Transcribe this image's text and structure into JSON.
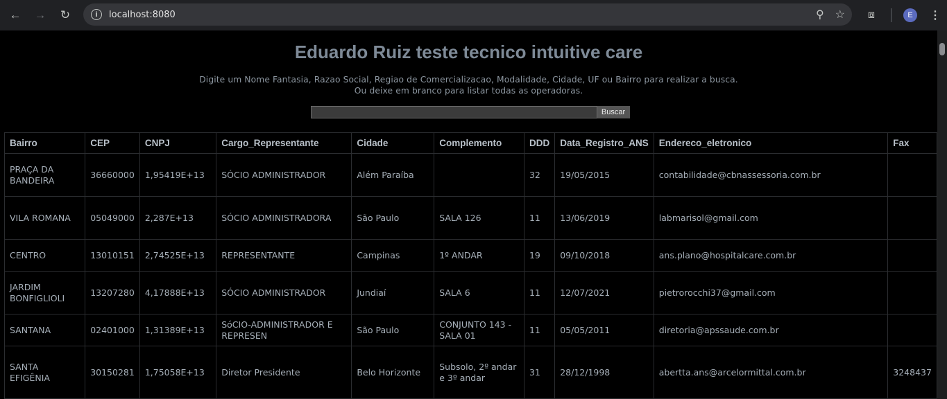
{
  "browser": {
    "url": "localhost:8080",
    "profile_initial": "E",
    "icons": {
      "back": "back-arrow-icon",
      "forward": "forward-arrow-icon",
      "reload": "reload-icon",
      "info": "site-info-icon",
      "zoom": "zoom-icon",
      "bookmark": "star-icon",
      "extensions": "puzzle-icon",
      "menu": "kebab-menu-icon"
    }
  },
  "page": {
    "title": "Eduardo Ruiz teste tecnico intuitive care",
    "hint_line1": "Digite um Nome Fantasia, Razao Social, Regiao de Comercializacao, Modalidade, Cidade, UF ou Bairro para realizar a busca.",
    "hint_line2": "Ou deixe em branco para listar todas as operadoras.",
    "search_value": "",
    "search_button": "Buscar"
  },
  "table": {
    "columns": [
      "Bairro",
      "CEP",
      "CNPJ",
      "Cargo_Representante",
      "Cidade",
      "Complemento",
      "DDD",
      "Data_Registro_ANS",
      "Endereco_eletronico",
      "Fax"
    ],
    "rows": [
      [
        "PRAÇA DA BANDEIRA",
        "36660000",
        "1,95419E+13",
        "SÓCIO ADMINISTRADOR",
        "Além Paraíba",
        "",
        "32",
        "19/05/2015",
        "contabilidade@cbnassessoria.com.br",
        ""
      ],
      [
        "VILA ROMANA",
        "05049000",
        "2,287E+13",
        "SÓCIO ADMINISTRADORA",
        "São Paulo",
        "SALA 126",
        "11",
        "13/06/2019",
        "labmarisol@gmail.com",
        ""
      ],
      [
        "CENTRO",
        "13010151",
        "2,74525E+13",
        "REPRESENTANTE",
        "Campinas",
        "1º ANDAR",
        "19",
        "09/10/2018",
        "ans.plano@hospitalcare.com.br",
        ""
      ],
      [
        "JARDIM BONFIGLIOLI",
        "13207280",
        "4,17888E+13",
        "SÓCIO ADMINISTRADOR",
        "Jundiaí",
        "SALA 6",
        "11",
        "12/07/2021",
        "pietrorocchi37@gmail.com",
        ""
      ],
      [
        "SANTANA",
        "02401000",
        "1,31389E+13",
        "SóCIO-ADMINISTRADOR E REPRESEN",
        "São Paulo",
        "CONJUNTO 143 - SALA 01",
        "11",
        "05/05/2011",
        "diretoria@apssaude.com.br",
        ""
      ],
      [
        "SANTA EFIGÊNIA",
        "30150281",
        "1,75058E+13",
        "Diretor Presidente",
        "Belo Horizonte",
        "Subsolo, 2º andar e 3º andar",
        "31",
        "28/12/1998",
        "abertta.ans@arcelormittal.com.br",
        "3248437"
      ]
    ]
  }
}
